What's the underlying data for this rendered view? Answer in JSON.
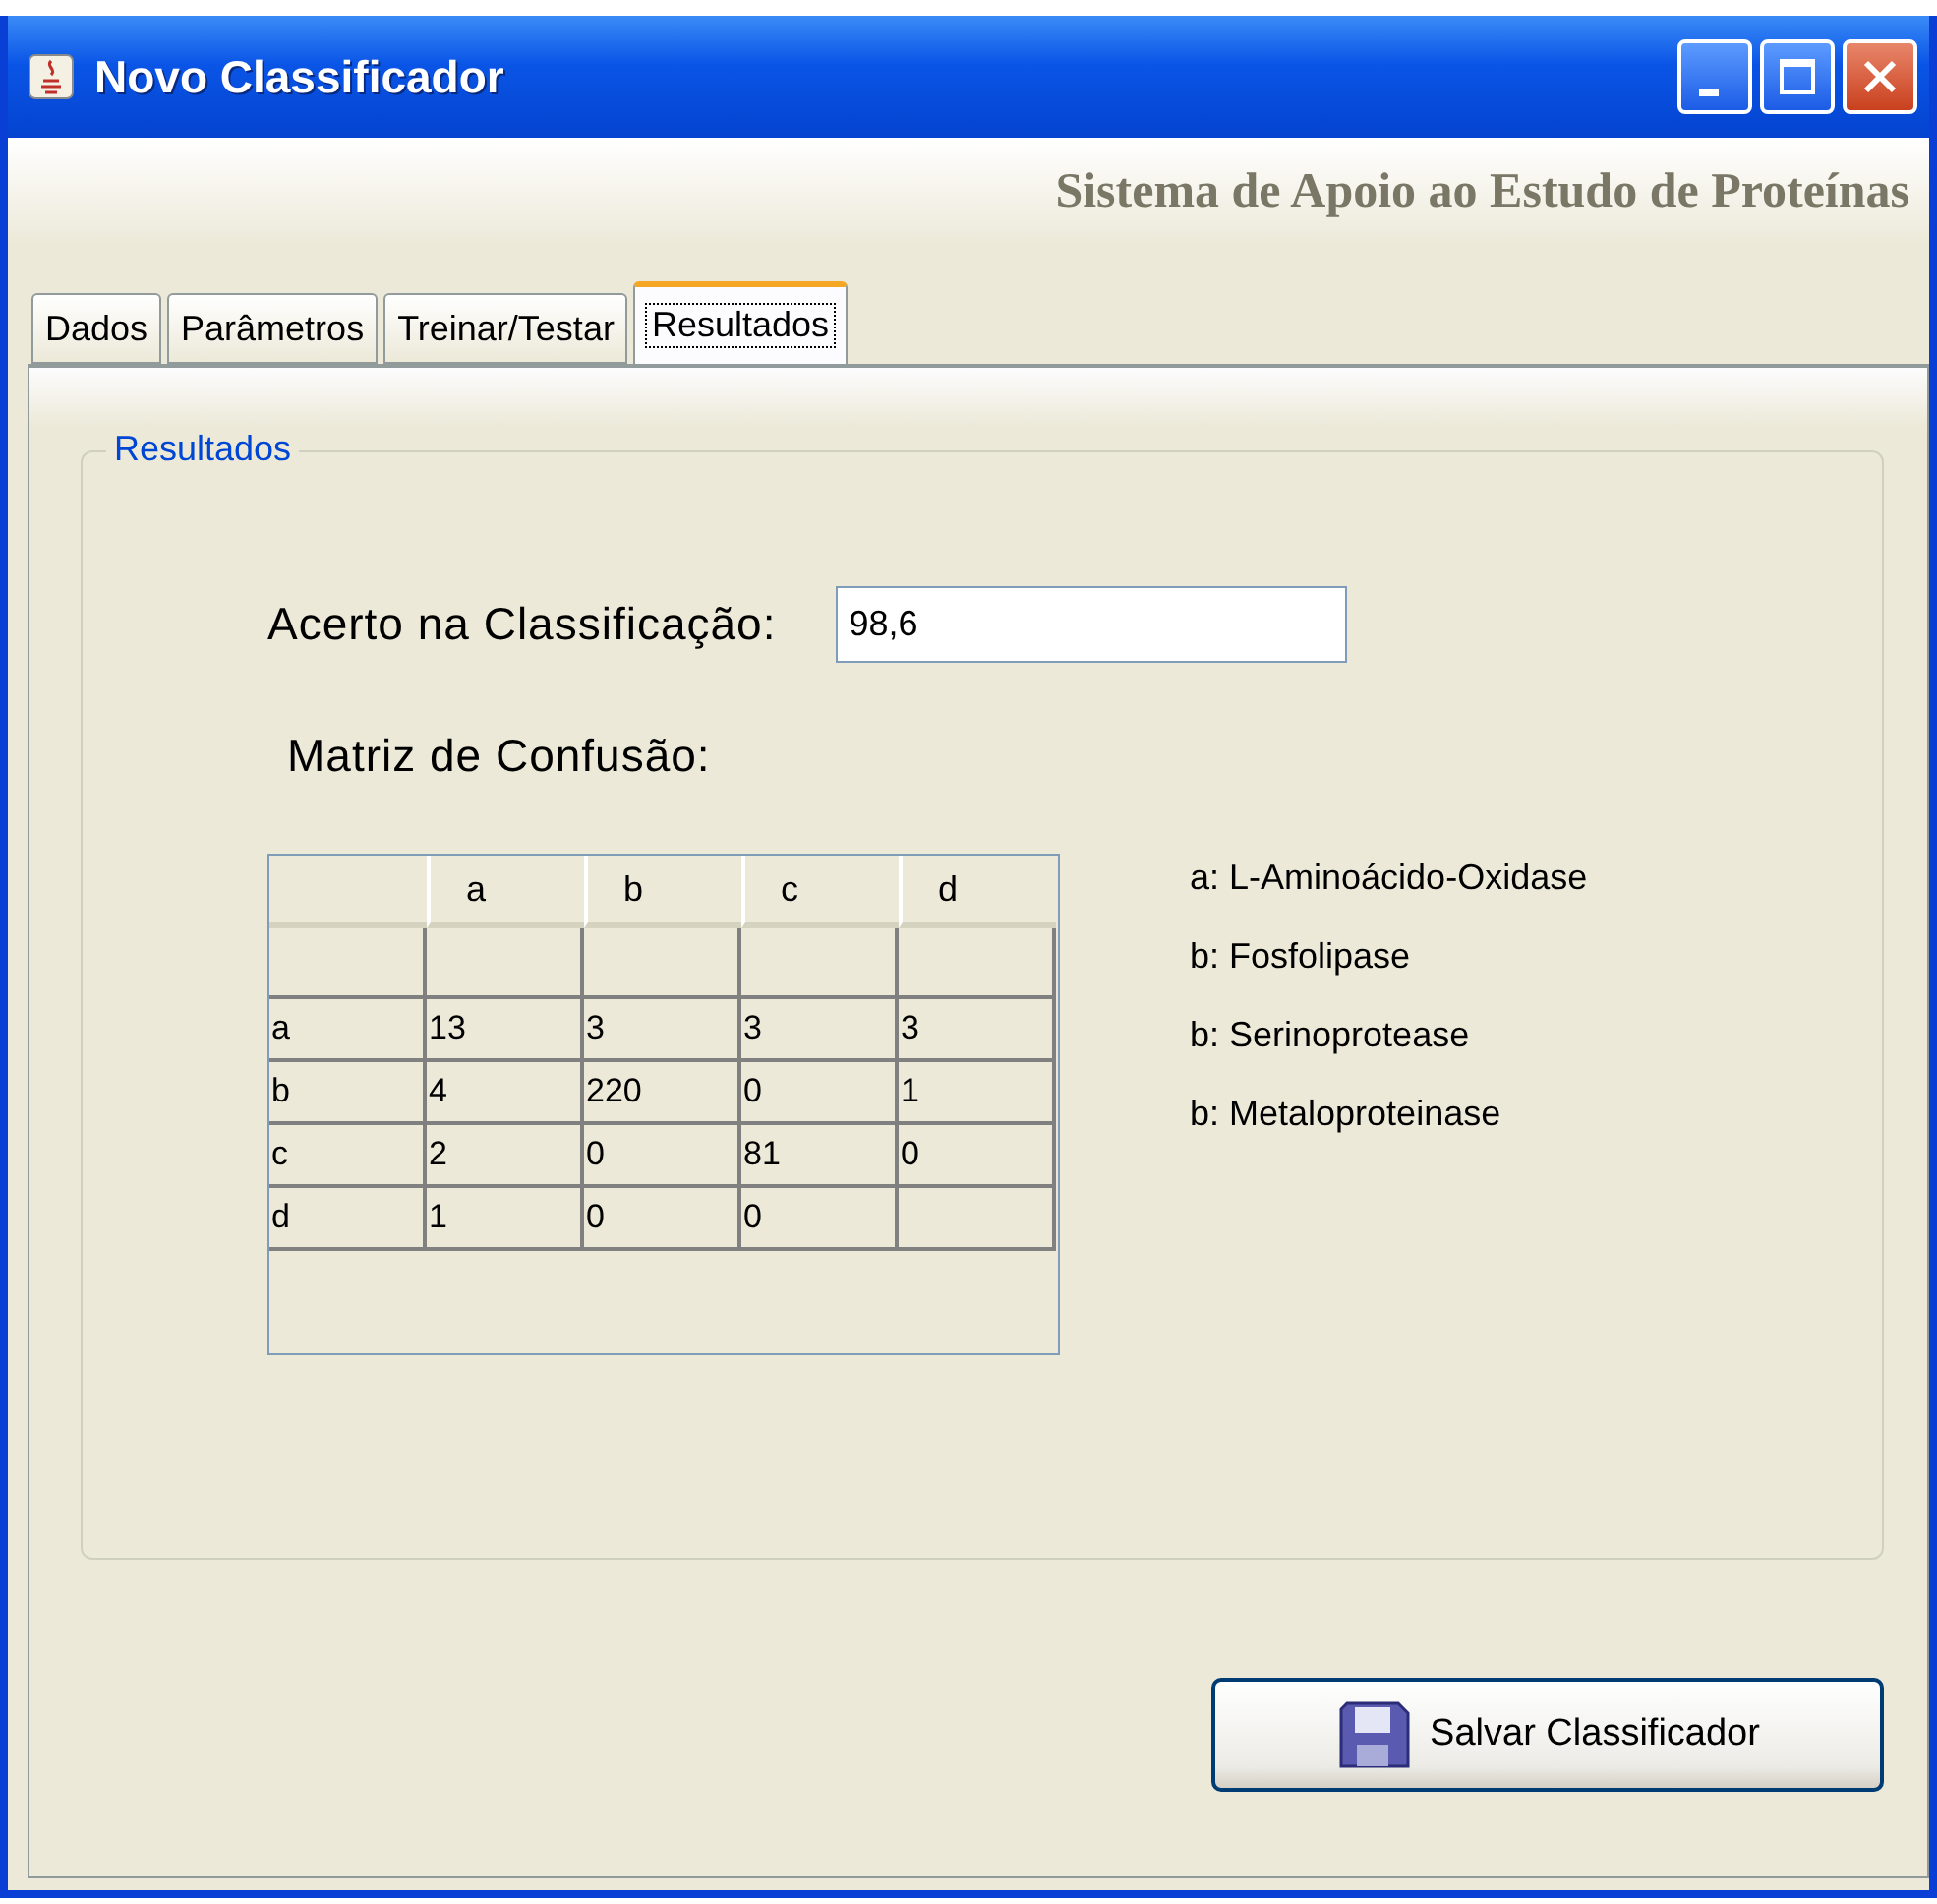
{
  "window": {
    "title": "Novo Classificador"
  },
  "header": {
    "title": "Sistema de Apoio ao Estudo de Proteínas"
  },
  "tabs": [
    {
      "label": "Dados",
      "selected": false
    },
    {
      "label": "Parâmetros",
      "selected": false
    },
    {
      "label": "Treinar/Testar",
      "selected": false
    },
    {
      "label": "Resultados",
      "selected": true
    }
  ],
  "group": {
    "title": "Resultados"
  },
  "accuracy": {
    "label": "Acerto na Classificação:",
    "value": "98,6"
  },
  "matrix": {
    "label": "Matriz de Confusão:",
    "columns": [
      "a",
      "b",
      "c",
      "d"
    ],
    "rows": [
      {
        "header": "a",
        "cells": [
          "13",
          "3",
          "3",
          "3"
        ]
      },
      {
        "header": "b",
        "cells": [
          "4",
          "220",
          "0",
          "1"
        ]
      },
      {
        "header": "c",
        "cells": [
          "2",
          "0",
          "81",
          "0"
        ]
      },
      {
        "header": "d",
        "cells": [
          "1",
          "0",
          "0",
          null
        ]
      }
    ]
  },
  "legend": [
    "a: L-Aminoácido-Oxidase",
    "b: Fosfolipase",
    "b: Serinoprotease",
    "b: Metaloproteinase"
  ],
  "buttons": [
    {
      "label": "Salvar Classificador"
    }
  ]
}
